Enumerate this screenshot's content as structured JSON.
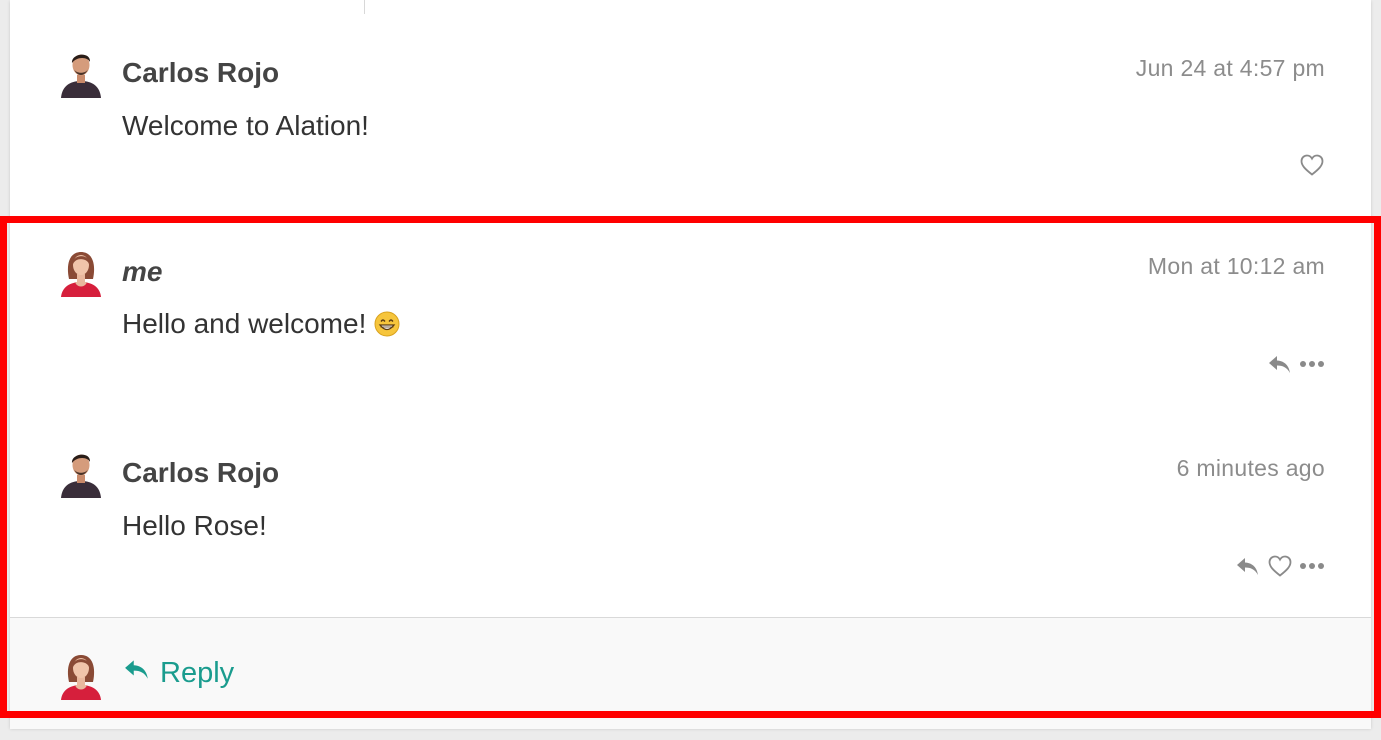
{
  "posts": [
    {
      "author": "Carlos Rojo",
      "timestamp": "Jun 24 at 4:57 pm",
      "body": "Welcome to Alation!",
      "avatar": "male-user-avatar"
    },
    {
      "author": "me",
      "timestamp": "Mon at 10:12 am",
      "body": "Hello and welcome!",
      "emoji": "grinning-face-emoji",
      "avatar": "female-user-avatar"
    },
    {
      "author": "Carlos Rojo",
      "timestamp": "6 minutes ago",
      "body": "Hello Rose!",
      "avatar": "male-user-avatar"
    }
  ],
  "footer": {
    "reply_label": "Reply",
    "avatar": "female-user-avatar"
  },
  "colors": {
    "accent": "#1a9c8e",
    "highlight_border": "#ff0000",
    "timestamp": "#8c8c8c",
    "icon": "#8a8a8a"
  },
  "icons": {
    "like": "heart-icon",
    "reply": "reply-arrow-icon",
    "more": "more-dots-icon"
  }
}
